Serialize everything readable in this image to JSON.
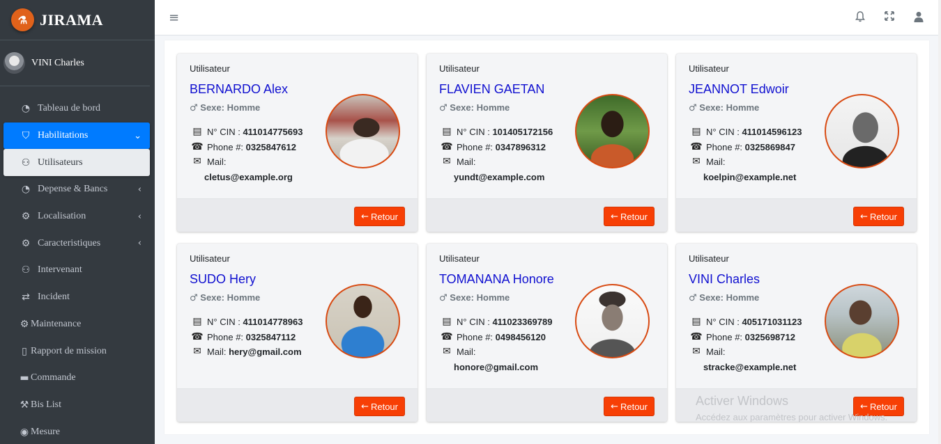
{
  "brand": {
    "logo_glyph": "⚗",
    "name": "JIRAMA"
  },
  "user": {
    "name": "VINI Charles"
  },
  "sidebar": {
    "items": [
      {
        "label": "Tableau de bord",
        "icon": "◔",
        "icon_name": "dashboard-icon",
        "arrow": ""
      },
      {
        "label": "Habilitations",
        "icon": "⛉",
        "icon_name": "user-lock-icon",
        "arrow": "⌄"
      },
      {
        "label": "Utilisateurs",
        "icon": "⚇",
        "icon_name": "users-cog-icon",
        "arrow": ""
      },
      {
        "label": "Depense & Bancs",
        "icon": "◔",
        "icon_name": "dashboard-icon",
        "arrow": "‹"
      },
      {
        "label": "Localisation",
        "icon": "⚙",
        "icon_name": "cogs-icon",
        "arrow": "‹"
      },
      {
        "label": "Caracteristiques",
        "icon": "⚙",
        "icon_name": "cogs-icon",
        "arrow": "‹"
      },
      {
        "label": "Intervenant",
        "icon": "⚇",
        "icon_name": "users-icon",
        "arrow": ""
      },
      {
        "label": "Incident",
        "icon": "⇄",
        "icon_name": "exchange-icon",
        "arrow": ""
      },
      {
        "label": "Maintenance",
        "icon": "⚙",
        "icon_name": "cog-icon",
        "arrow": ""
      },
      {
        "label": "Rapport de mission",
        "icon": "▯",
        "icon_name": "file-icon",
        "arrow": ""
      },
      {
        "label": "Commande",
        "icon": "▬",
        "icon_name": "credit-card-icon",
        "arrow": ""
      },
      {
        "label": "Bis List",
        "icon": "⚒",
        "icon_name": "magic-icon",
        "arrow": ""
      },
      {
        "label": "Mesure",
        "icon": "◉",
        "icon_name": "podcast-icon",
        "arrow": ""
      }
    ]
  },
  "topbar": {
    "menu_icon": "≡",
    "bell_icon": "␇",
    "expand_icon": "⤢",
    "user_icon": "●"
  },
  "labels": {
    "card_header": "Utilisateur",
    "sexe_prefix": "Sexe:",
    "cin_prefix": "N° CIN :",
    "phone_prefix": "Phone #:",
    "mail_prefix": "Mail:",
    "retour": "Retour",
    "male_symbol": "♂",
    "id_icon": "▤",
    "phone_icon": "☎",
    "mail_icon": "✉",
    "back_arrow": "←"
  },
  "users": [
    {
      "name": "BERNARDO Alex",
      "sexe": "Homme",
      "cin": "411014775693",
      "phone": "0325847612",
      "mail": "cletus@example.org",
      "mail_inline": false,
      "photo": "bg-port"
    },
    {
      "name": "FLAVIEN GAETAN",
      "sexe": "Homme",
      "cin": "101405172156",
      "phone": "0347896312",
      "mail": "yundt@example.com",
      "mail_inline": false,
      "photo": "bg-green"
    },
    {
      "name": "JEANNOT Edwoir",
      "sexe": "Homme",
      "cin": "411014596123",
      "phone": "0325869847",
      "mail": "koelpin@example.net",
      "mail_inline": false,
      "photo": "bg-bw"
    },
    {
      "name": "SUDO Hery",
      "sexe": "Homme",
      "cin": "411014778963",
      "phone": "0325847112",
      "mail": "hery@gmail.com",
      "mail_inline": true,
      "photo": "bg-blue"
    },
    {
      "name": "TOMANANA Honore",
      "sexe": "Homme",
      "cin": "411023369789",
      "phone": "0498456120",
      "mail": "honore@gmail.com",
      "mail_inline": false,
      "photo": "bg-white"
    },
    {
      "name": "VINI Charles",
      "sexe": "Homme",
      "cin": "405171031123",
      "phone": "0325698712",
      "mail": "stracke@example.net",
      "mail_inline": false,
      "photo": "bg-outdoor"
    }
  ],
  "watermark": {
    "line1": "Activer Windows",
    "line2": "Accédez aux paramètres pour activer Windows."
  },
  "colors": {
    "sidebar": "#343a40",
    "active": "#007bff",
    "name_link": "#1010d0",
    "button": "#f73f05"
  }
}
